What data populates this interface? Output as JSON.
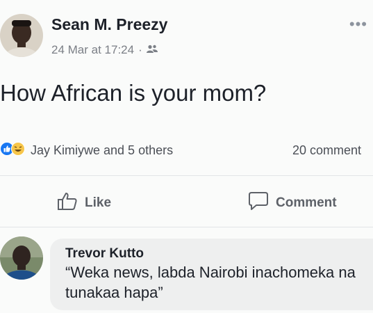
{
  "post": {
    "author": "Sean M. Preezy",
    "date": "24 Mar at 17:24",
    "separator": "·",
    "text": "How African is your mom?",
    "reactions_text": "Jay Kimiywe and 5 others",
    "comments_count": "20 comment",
    "like_label": "Like",
    "comment_label": "Comment",
    "more_icon": "more-dots-icon",
    "privacy_icon": "friends-icon"
  },
  "comment": {
    "author": "Trevor Kutto",
    "text": "“Weka news, labda Nairobi inachomeka na tunakaa hapa”"
  },
  "colors": {
    "like_blue": "#1877f2",
    "haha_yellow": "#f7c64a",
    "bubble_bg": "#eeefef"
  }
}
